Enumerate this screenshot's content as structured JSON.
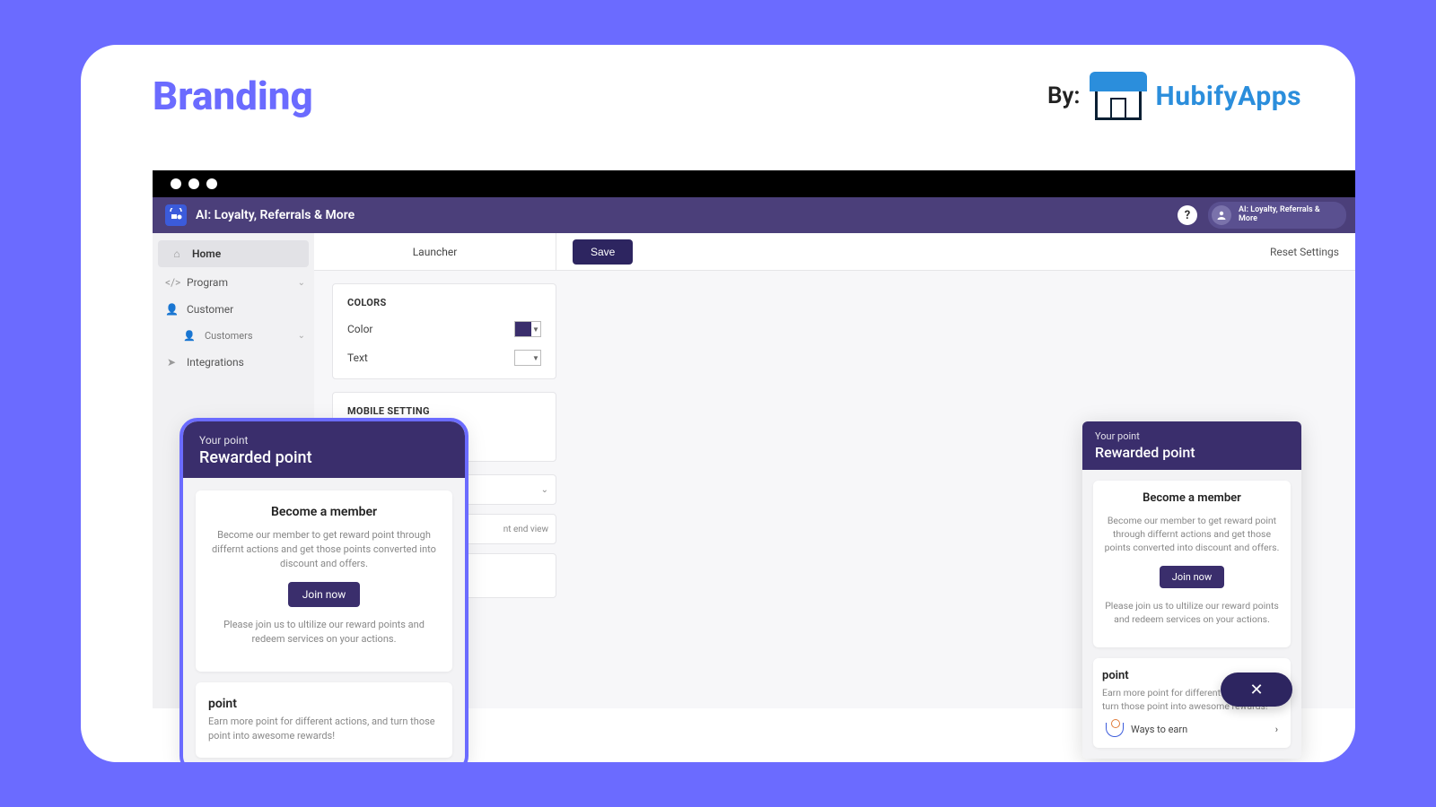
{
  "page": {
    "title": "Branding",
    "by": "By:",
    "brand": "HubifyApps"
  },
  "app": {
    "name": "AI: Loyalty, Referrals & More",
    "help": "?",
    "user_label": "AI: Loyalty, Referrals & More"
  },
  "sidebar": {
    "home": "Home",
    "program": "Program",
    "customer": "Customer",
    "customers": "Customers",
    "integrations": "Integrations"
  },
  "toolbar": {
    "launcher": "Launcher",
    "save": "Save",
    "reset": "Reset Settings"
  },
  "colors_panel": {
    "title": "COLORS",
    "color_label": "Color",
    "text_label": "Text",
    "color_value": "#3a2e6c",
    "text_value": "#ffffff"
  },
  "mobile_panel": {
    "title": "MOBILE SETTING"
  },
  "strip": {
    "caption": "nt end view"
  },
  "preview": {
    "sub": "Your point",
    "title": "Rewarded point",
    "member_h": "Become a member",
    "member_p": "Become our member to get reward point through differnt actions and get those points converted into discount and offers.",
    "join": "Join now",
    "note": "Please join us to ultilize our reward points and redeem services on your actions.",
    "point_h": "point",
    "point_p": "Earn more point for different actions, and turn those point into awesome rewards!",
    "ways": "Ways to earn"
  },
  "close": "✕"
}
